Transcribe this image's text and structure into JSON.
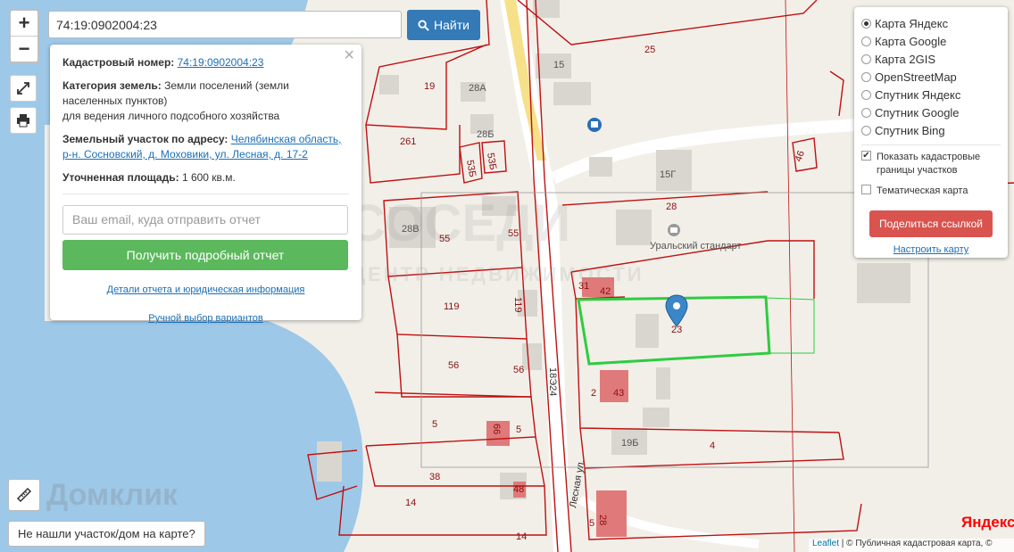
{
  "search": {
    "value": "74:19:0902004:23",
    "button_label": "Найти"
  },
  "zoom": {
    "in": "+",
    "out": "−"
  },
  "info": {
    "cad_label": "Кадастровый номер:",
    "cad_value": "74:19:0902004:23",
    "category_label": "Категория земель:",
    "category_value": "Земли поселений (земли населенных пунктов)",
    "category_sub": "для ведения личного подсобного хозяйства",
    "address_label": "Земельный участок по адресу:",
    "address_value": "Челябинская область, р-н. Сосновский, д. Моховики, ул. Лесная, д. 17-2",
    "area_label": "Уточненная площадь:",
    "area_value": "1 600 кв.м.",
    "email_placeholder": "Ваш email, куда отправить отчет",
    "report_button": "Получить подробный отчет",
    "details_link": "Детали отчета и юридическая информация",
    "manual_link": "Ручной выбор вариантов"
  },
  "layers": {
    "options": [
      "Карта Яндекс",
      "Карта Google",
      "Карта 2GIS",
      "OpenStreetMap",
      "Спутник Яндекс",
      "Спутник Google",
      "Спутник Bing"
    ],
    "selected": "Карта Яндекс",
    "show_borders_label": "Показать кадастровые границы участков",
    "show_borders_checked": true,
    "thematic_label": "Тематическая карта",
    "thematic_checked": false,
    "share_button": "Поделиться ссылкой",
    "configure_link": "Настроить карту"
  },
  "bottom": {
    "not_found": "Не нашли участок/дом на карте?",
    "watermark": "Домклик",
    "yandex_logo": "Яндекс",
    "attribution_leaflet": "Leaflet",
    "attribution_rest": " | © Публичная кадастровая карта, ©"
  },
  "map_labels": {
    "parcels": [
      "25",
      "15",
      "19",
      "28А",
      "28Б",
      "261",
      "53Б",
      "53Б",
      "15Г",
      "28",
      "28В",
      "55",
      "55",
      "31",
      "42",
      "23",
      "119",
      "119",
      "56",
      "56",
      "2",
      "43",
      "5",
      "5",
      "66",
      "19Б",
      "4",
      "38",
      "48",
      "14",
      "14",
      "28",
      "5",
      "46"
    ],
    "poi": "Уральский стандарт",
    "road_number": "18Э24",
    "street": "Лесная ул."
  },
  "colors": {
    "parcel_border": "#c01010",
    "selected_parcel": "#2ecc40",
    "water": "#9ec8e8",
    "accent_blue": "#337ab7",
    "green": "#5cb85c",
    "red": "#d9534f"
  }
}
